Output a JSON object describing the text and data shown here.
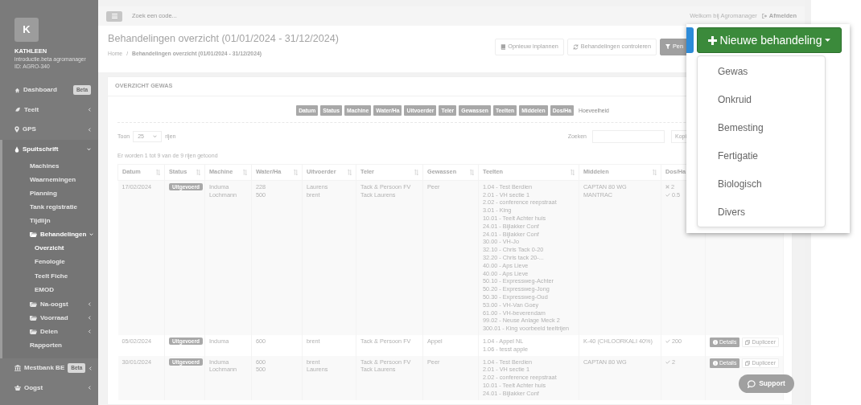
{
  "sidebar": {
    "avatar": "K",
    "user": "KATHLEEN",
    "account": "introductie.beta agromanager",
    "id": "ID: AGRO-340",
    "items": [
      {
        "label": "Dashboard",
        "kind": "home",
        "badge": "Beta",
        "selected": false
      },
      {
        "label": "Teelt",
        "kind": "leaf",
        "expanded": false,
        "selected": false
      },
      {
        "label": "GPS",
        "kind": "pin",
        "expanded": false,
        "selected": false
      },
      {
        "label": "Spuitschrift",
        "kind": "drop",
        "expanded": true,
        "selected": true,
        "children": [
          {
            "label": "Machines",
            "selected": false
          },
          {
            "label": "Waarnemingen",
            "selected": false
          },
          {
            "label": "Planning",
            "selected": false
          },
          {
            "label": "Tank registratie",
            "selected": false
          },
          {
            "label": "Tijdlijn",
            "selected": false
          },
          {
            "label": "Behandelingen",
            "kind": "folder",
            "expanded": true,
            "selected": true,
            "children": [
              {
                "label": "Overzicht",
                "selected": true
              },
              {
                "label": "Fenologie",
                "selected": false
              },
              {
                "label": "Teelt Fiche",
                "selected": false
              },
              {
                "label": "EMOD",
                "selected": false
              }
            ]
          },
          {
            "label": "Na-oogst",
            "kind": "folder",
            "expanded": false,
            "selected": false
          },
          {
            "label": "Voorraad",
            "kind": "folder",
            "expanded": false,
            "selected": false
          },
          {
            "label": "Delen",
            "kind": "folder",
            "expanded": false,
            "selected": false
          },
          {
            "label": "Rapporten",
            "selected": false
          }
        ]
      },
      {
        "label": "Mestbank BE",
        "kind": "bank",
        "badge": "Beta",
        "expanded": false,
        "selected": false
      },
      {
        "label": "Oogst",
        "kind": "basket",
        "expanded": false,
        "selected": false
      }
    ]
  },
  "topbar": {
    "search_placeholder": "Zoek een code...",
    "welcome": "Welkom bij Agromanager",
    "logout": "Afmelden"
  },
  "page": {
    "title": "Behandelingen overzicht (01/01/2024 - 31/12/2024)",
    "breadcrumb": [
      "Home",
      "Behandelingen overzicht (01/01/2024 - 31/12/2024)"
    ],
    "breadcrumb_separator": "/",
    "actions": [
      {
        "kind": "book",
        "label": "Opnieuw inplannen"
      },
      {
        "kind": "sync",
        "label": "Behandelingen controleren"
      },
      {
        "kind": "filter",
        "label": "Pen"
      }
    ]
  },
  "card": {
    "title": "OVERZICHT GEWAS",
    "column_toggles": [
      {
        "label": "Datum",
        "selected": true
      },
      {
        "label": "Status",
        "selected": true
      },
      {
        "label": "Machine",
        "selected": true
      },
      {
        "label": "Water/Ha",
        "selected": true
      },
      {
        "label": "Uitvoerder",
        "selected": true
      },
      {
        "label": "Teler",
        "selected": true
      },
      {
        "label": "Gewassen",
        "selected": true
      },
      {
        "label": "Teelten",
        "selected": true
      },
      {
        "label": "Middelen",
        "selected": true
      },
      {
        "label": "Dos/Ha",
        "selected": true
      },
      {
        "label": "Hoeveelheid",
        "selected": false
      }
    ],
    "length": {
      "before": "Toon",
      "value": "25",
      "after": "rijen"
    },
    "search_label": "Zoeken",
    "copy_button": "Kopi",
    "info": "Er worden 1 tot 9 van de 9 rijen getoond",
    "table": {
      "columns": [
        {
          "label": "Datum",
          "sortable": true
        },
        {
          "label": "Status",
          "sortable": true
        },
        {
          "label": "Machine",
          "sortable": true
        },
        {
          "label": "Water/Ha",
          "sortable": true
        },
        {
          "label": "Uitvoerder",
          "sortable": true
        },
        {
          "label": "Teler",
          "sortable": true
        },
        {
          "label": "Gewassen",
          "sortable": true
        },
        {
          "label": "Teelten",
          "sortable": true
        },
        {
          "label": "Middelen",
          "sortable": true
        },
        {
          "label": "Dos/Ha",
          "sortable": false
        }
      ],
      "rows": [
        {
          "datum": "17/02/2024",
          "status": "Uitgevoerd",
          "machine": [
            "Induma",
            "Lochmann"
          ],
          "water": [
            "228",
            "500"
          ],
          "uitvoerder": [
            "Laurens",
            "brent"
          ],
          "teler": [
            "Tack & Persoon FV",
            "Tack Laurens"
          ],
          "gewassen": [
            "Peer"
          ],
          "teelten": [
            "1.04 - Test Berdien",
            "2.01 - VH sectie 1",
            "2.02 - conference reepstraat",
            "3.01 - King",
            "10.01 - Teelt Achter huis",
            "24.01 - Bijlakker Conf",
            "24.01 - Bijlakker Conf",
            "30.00 - VH-Jo",
            "32.10 - Chris Tack 0-20",
            "32.20 - Chris tack 20-...",
            "40.00 - Aps Lieve",
            "40.00 - Aps Lieve",
            "50.10 - Expressweg-Achter",
            "50.20 - Expressweg-Jong",
            "50.30 - Expressweg-Oud",
            "53.00 - VH-Van Goey",
            "61.00 - VH-beverendam",
            "99.02 - Neuse Anlage Meck 2",
            "300.01 - King voorbeeld teeltrijen"
          ],
          "middelen": [
            "CAPTAN 80 WG",
            "MANTRAC"
          ],
          "dosis": [
            {
              "ok": false,
              "value": "2"
            },
            {
              "ok": true,
              "value": "0.5"
            }
          ]
        },
        {
          "datum": "05/02/2024",
          "status": "Uitgevoerd",
          "machine": [
            "Induma"
          ],
          "water": [
            "600"
          ],
          "uitvoerder": [
            "brent"
          ],
          "teler": [
            "Tack & Persoon FV"
          ],
          "gewassen": [
            "Appel"
          ],
          "teelten": [
            "1.04 - Appel NL",
            "1.06 - tesst apple"
          ],
          "middelen": [
            "K-40 (CHLOORKALI 40%)"
          ],
          "dosis": [
            {
              "ok": true,
              "value": "200"
            }
          ],
          "actions": [
            {
              "kind": "details",
              "label": "Details"
            },
            {
              "kind": "duplicate",
              "label": "Dupliceer"
            }
          ]
        },
        {
          "datum": "30/01/2024",
          "status": "Uitgevoerd",
          "machine": [
            "Induma",
            "Lochmann"
          ],
          "water": [
            "600",
            "500"
          ],
          "uitvoerder": [
            "brent",
            "Laurens"
          ],
          "teler": [
            "Tack & Persoon FV",
            "Tack Laurens"
          ],
          "gewassen": [
            "Peer"
          ],
          "teelten": [
            "1.04 - Test Berdien",
            "2.01 - VH sectie 1",
            "2.02 - conference reepstraat",
            "10.01 - Teelt Achter huis",
            "24.01 - Bijlakker Conf"
          ],
          "middelen": [
            "CAPTAN 80 WG"
          ],
          "dosis": [
            {
              "ok": true,
              "value": "2"
            }
          ],
          "actions": [
            {
              "kind": "details",
              "label": "Details"
            },
            {
              "kind": "duplicate",
              "label": "Dupliceer"
            }
          ]
        }
      ]
    }
  },
  "new_menu": {
    "button": "Nieuwe behandeling",
    "items": [
      "Gewas",
      "Onkruid",
      "Bemesting",
      "Fertigatie",
      "Biologisch",
      "Divers"
    ]
  },
  "support": "Support"
}
